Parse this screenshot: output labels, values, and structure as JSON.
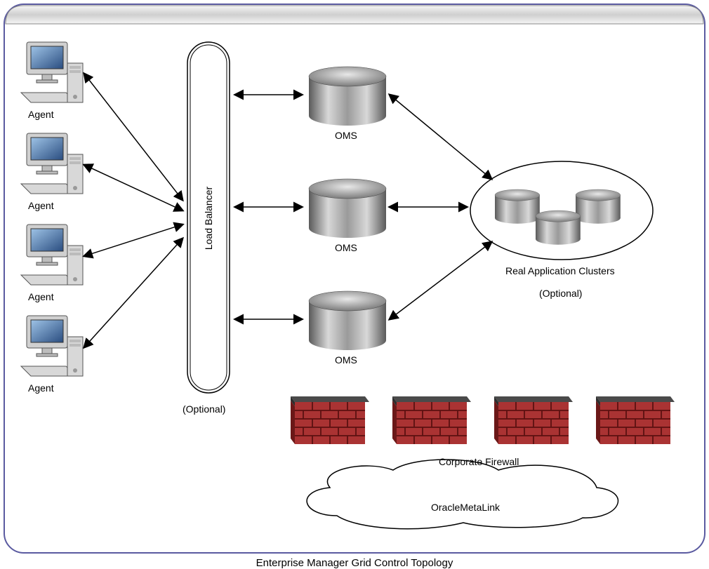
{
  "title": "Enterprise Manager Grid Control Topology",
  "agents": {
    "label": "Agent"
  },
  "load_balancer": {
    "label": "Load Balancer",
    "optional": "(Optional)"
  },
  "oms": {
    "label": "OMS"
  },
  "rac": {
    "label": "Real Application Clusters",
    "optional": "(Optional)"
  },
  "firewall": {
    "label": "Corporate Firewall"
  },
  "metalink": {
    "label": "OracleMetaLink"
  }
}
